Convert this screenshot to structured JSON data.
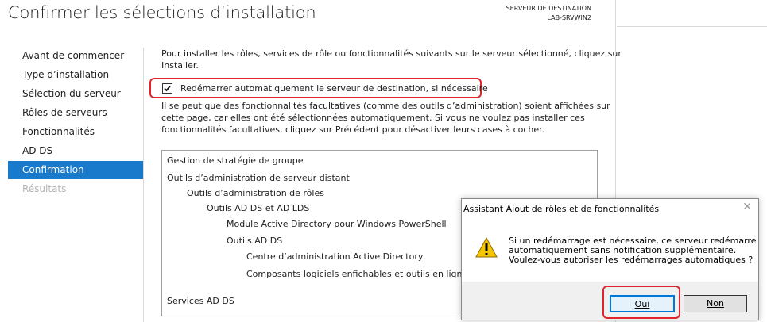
{
  "page": {
    "title": "Confirmer les sélections d’installation",
    "destination_label": "SERVEUR DE DESTINATION",
    "destination_server": "LAB-SRVWIN2"
  },
  "nav": {
    "items": [
      {
        "label": "Avant de commencer",
        "state": "normal"
      },
      {
        "label": "Type d’installation",
        "state": "normal"
      },
      {
        "label": "Sélection du serveur",
        "state": "normal"
      },
      {
        "label": "Rôles de serveurs",
        "state": "normal"
      },
      {
        "label": "Fonctionnalités",
        "state": "normal"
      },
      {
        "label": "AD DS",
        "state": "normal"
      },
      {
        "label": "Confirmation",
        "state": "active"
      },
      {
        "label": "Résultats",
        "state": "disabled"
      }
    ]
  },
  "main": {
    "intro_line1": "Pour installer les rôles, services de rôle ou fonctionnalités suivants sur le serveur sélectionné, cliquez sur",
    "intro_line2": "Installer.",
    "restart_checkbox_label": "Redémarrer automatiquement le serveur de destination, si nécessaire",
    "restart_checked": true,
    "note_line1": "Il se peut que des fonctionnalités facultatives (comme des outils d’administration) soient affichées sur",
    "note_line2": "cette page, car elles ont été sélectionnées automatiquement. Si vous ne voulez pas installer ces",
    "note_line3": "fonctionnalités facultatives, cliquez sur Précédent pour désactiver leurs cases à cocher."
  },
  "features": [
    "Gestion de stratégie de groupe",
    "Outils d’administration de serveur distant",
    "Outils d’administration de rôles",
    "Outils AD DS et AD LDS",
    "Module Active Directory pour Windows PowerShell",
    "Outils AD DS",
    "Centre d’administration Active Directory",
    "Composants logiciels enfichables et outils en ligne",
    "Services AD DS"
  ],
  "dialog": {
    "title": "Assistant Ajout de rôles et de fonctionnalités",
    "close_glyph": "✕",
    "message_line1": "Si un redémarrage est nécessaire, ce serveur redémarre",
    "message_line2": "automatiquement sans notification supplémentaire.",
    "message_line3": "Voulez-vous autoriser les redémarrages automatiques ?",
    "icon": "warning-icon",
    "yes_label": "Oui",
    "no_label": "Non"
  },
  "colors": {
    "accent": "#1979ca",
    "highlight": "#e0262c",
    "warning": "#f7c600"
  }
}
